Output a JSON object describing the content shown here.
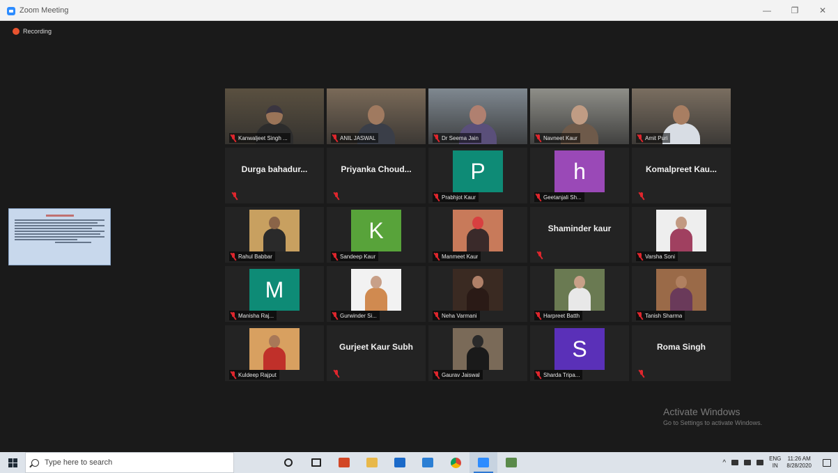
{
  "window": {
    "title": "Zoom Meeting",
    "minimize": "—",
    "restore": "❐",
    "close": "✕"
  },
  "recording": {
    "label": "Recording"
  },
  "tiles": [
    {
      "kind": "video",
      "name": "Kanwaljeet Singh ...",
      "active": true,
      "scene": "#5a5040",
      "skin": "#9a7458",
      "top": "#2c2c2c",
      "head_top": "#3a3540"
    },
    {
      "kind": "video",
      "name": "ANIL JASWAL",
      "scene": "#7a6a58",
      "skin": "#a07a60",
      "top": "#3a3e48"
    },
    {
      "kind": "video",
      "name": "Dr Seema Jain",
      "scene": "#7f8890",
      "skin": "#b08070",
      "top": "#5a4f7a"
    },
    {
      "kind": "video",
      "name": "Navneet Kaur",
      "scene": "#8e8e88",
      "skin": "#c09c84",
      "top": "#6e5a4a"
    },
    {
      "kind": "video",
      "name": "Amit Puri",
      "scene": "#7a6e60",
      "skin": "#a87e62",
      "top": "#d8dde4"
    },
    {
      "kind": "name",
      "name": "Durga bahadur..."
    },
    {
      "kind": "name",
      "name": "Priyanka Choud..."
    },
    {
      "kind": "letter",
      "letter": "P",
      "color": "#0e8b76",
      "name": "Prabhjot Kaur"
    },
    {
      "kind": "letter",
      "letter": "h",
      "color": "#9a49b7",
      "name": "Geetanjali Sh..."
    },
    {
      "kind": "name",
      "name": "Komalpreet Kau..."
    },
    {
      "kind": "photo",
      "name": "Rahul Babbar",
      "bg": "#c8a060",
      "skin": "#8a6448",
      "top": "#2a2a2a"
    },
    {
      "kind": "letter",
      "letter": "K",
      "color": "#58a33a",
      "name": "Sandeep Kaur"
    },
    {
      "kind": "photo",
      "name": "Manmeet Kaur",
      "bg": "#c87a5a",
      "skin": "#d84040",
      "top": "#3a2a2a"
    },
    {
      "kind": "name",
      "name": "Shaminder kaur"
    },
    {
      "kind": "photo",
      "name": "Varsha Soni",
      "bg": "#eeeeee",
      "skin": "#c29a82",
      "top": "#a04060"
    },
    {
      "kind": "letter",
      "letter": "M",
      "color": "#0e8b76",
      "name": "Manisha Raj..."
    },
    {
      "kind": "photo",
      "name": "Gurwinder Si...",
      "bg": "#f2f2f2",
      "skin": "#c8a088",
      "top": "#d08a50"
    },
    {
      "kind": "photo",
      "name": "Neha Varmani",
      "bg": "#3a2a22",
      "skin": "#b08068",
      "top": "#2a1a16"
    },
    {
      "kind": "photo",
      "name": "Harpreet Batth",
      "bg": "#6a7a52",
      "skin": "#c8a088",
      "top": "#e8e8e8"
    },
    {
      "kind": "photo",
      "name": "Tanish Sharma",
      "bg": "#9a6a48",
      "skin": "#b08060",
      "top": "#6a3a5a"
    },
    {
      "kind": "photo",
      "name": "Kuldeep Rajput",
      "bg": "#d8a060",
      "skin": "#a87858",
      "top": "#c0302a"
    },
    {
      "kind": "name",
      "name": "Gurjeet Kaur Subh"
    },
    {
      "kind": "photo",
      "name": "Gaurav Jaiswal",
      "bg": "#7a6a58",
      "skin": "#2a2a2a",
      "top": "#1a1a1a"
    },
    {
      "kind": "letter",
      "letter": "S",
      "color": "#5a30b8",
      "name": "Sharda Tripa..."
    },
    {
      "kind": "name",
      "name": "Roma Singh"
    }
  ],
  "activate_windows": {
    "line1": "Activate Windows",
    "line2": "Go to Settings to activate Windows."
  },
  "taskbar": {
    "search_placeholder": "Type here to search",
    "apps": [
      {
        "icon": "cortana-icon",
        "color": "#222"
      },
      {
        "icon": "task-view-icon",
        "color": "#222"
      },
      {
        "icon": "office-icon",
        "color": "#d24726"
      },
      {
        "icon": "file-explorer-icon",
        "color": "#e8b84a"
      },
      {
        "icon": "mail-icon",
        "color": "#1b6ac9"
      },
      {
        "icon": "store-icon",
        "color": "#2b7fd4"
      },
      {
        "icon": "chrome-icon",
        "color": "#e4a43a"
      },
      {
        "icon": "zoom-icon",
        "color": "#2d8cff",
        "active": true
      },
      {
        "icon": "paint-icon",
        "color": "#5a8a4a"
      }
    ],
    "lang_top": "ENG",
    "lang_bottom": "IN",
    "time": "11:26 AM",
    "date": "8/28/2020"
  }
}
